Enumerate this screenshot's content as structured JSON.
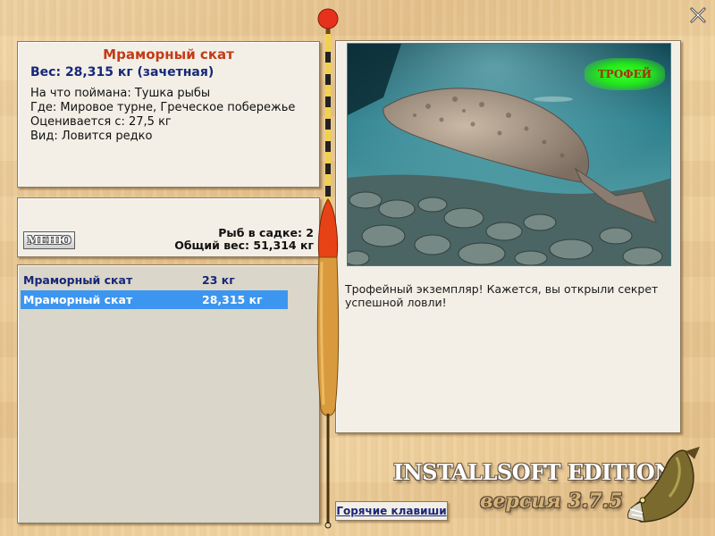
{
  "fish": {
    "name": "Мраморный скат",
    "weight_line": "Вес: 28,315 кг (зачетная)",
    "bait_line": "На что поймана: Тушка рыбы",
    "place_line": "Где: Мировое турне, Греческое побережье",
    "valued_line": "Оценивается с: 27,5 кг",
    "rarity_line": "Вид: Ловится редко"
  },
  "summary": {
    "menu_label": "МЕНЮ",
    "fish_count": "Рыб в садке: 2",
    "total_weight": "Общий вес: 51,314 кг"
  },
  "catch_list": [
    {
      "name": "Мраморный скат",
      "weight": "23 кг",
      "selected": false
    },
    {
      "name": "Мраморный скат",
      "weight": "28,315 кг",
      "selected": true
    }
  ],
  "trophy": {
    "badge": "ТРОФЕЙ",
    "description": "Трофейный экземпляр! Кажется, вы открыли секрет успешной ловли!"
  },
  "footer": {
    "hotkeys_label": "Горячие клавиши",
    "brand": "INSTALLSOFT EDITION",
    "version": "версия 3.7.5"
  },
  "icons": {
    "close": "close-icon",
    "float": "fishing-float-icon",
    "pike": "pike-fish-icon"
  },
  "colors": {
    "title": "#c23b18",
    "accent_text": "#17277a",
    "selection": "#3c96f0",
    "trophy_glow": "#22e818"
  }
}
